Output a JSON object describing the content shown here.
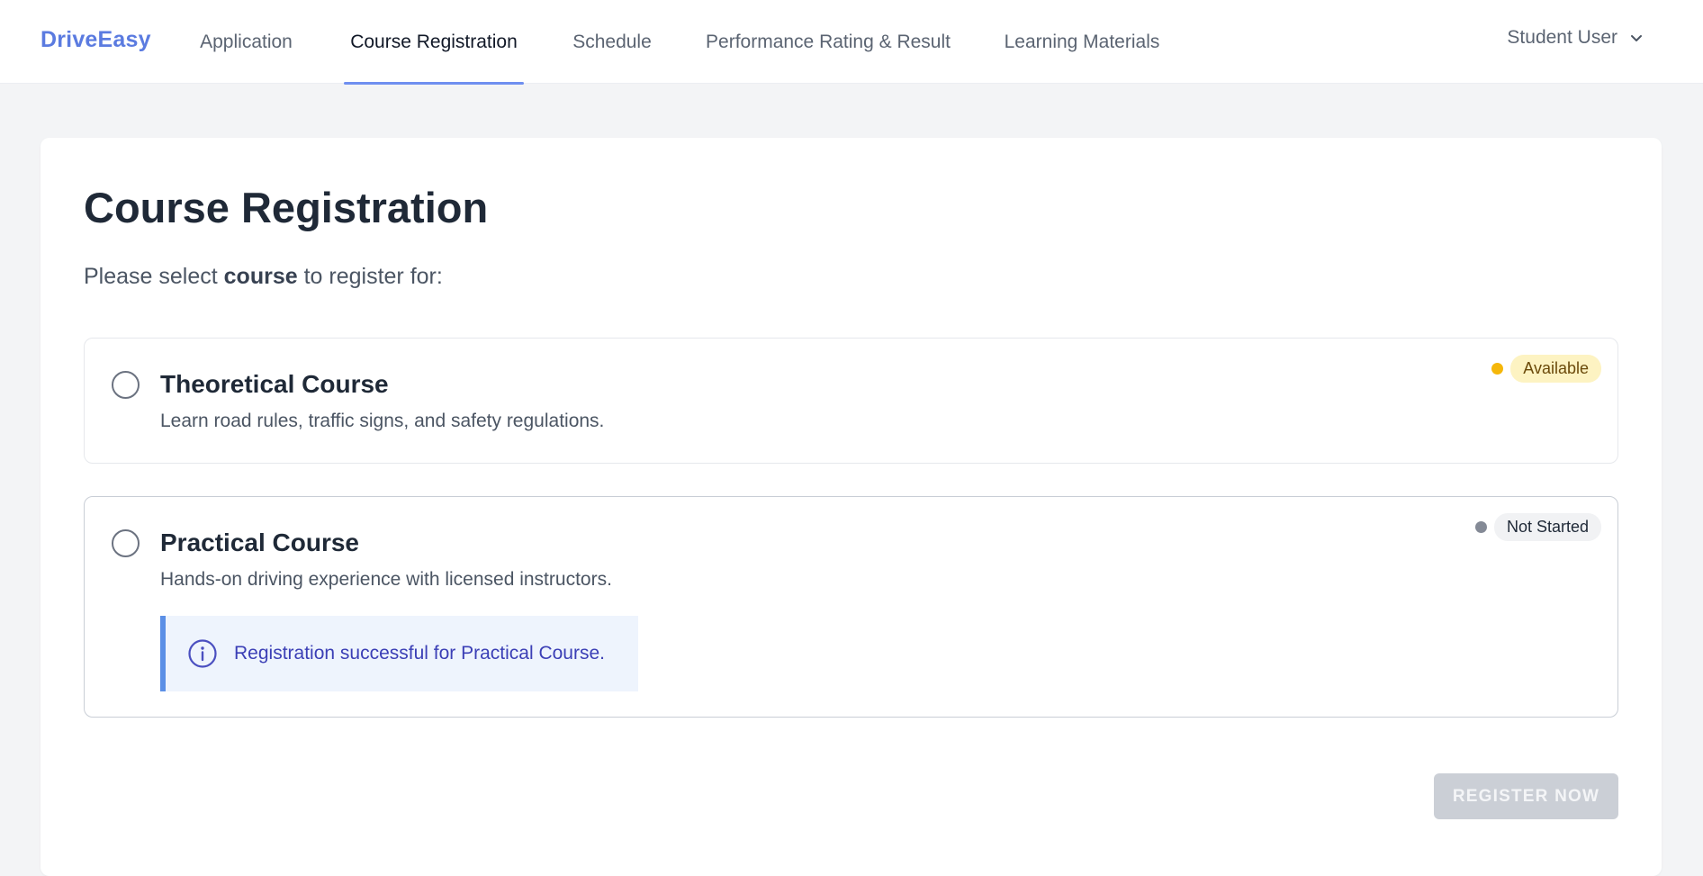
{
  "brand": "DriveEasy",
  "nav": {
    "items": [
      {
        "label": "Application"
      },
      {
        "label": "Course Registration",
        "active": true
      },
      {
        "label": "Schedule"
      },
      {
        "label": "Performance Rating & Result"
      },
      {
        "label": "Learning Materials"
      }
    ]
  },
  "user_menu": {
    "label": "Student User",
    "icon": "chevron-down-icon"
  },
  "page": {
    "title": "Course Registration",
    "subtitle_prefix": "Please select",
    "subtitle_bold": "course",
    "subtitle_suffix": "to register for:"
  },
  "courses": [
    {
      "title": "Theoretical Course",
      "description": "Learn road rules, traffic signs, and safety regulations.",
      "status": "Available",
      "status_color": "#f5b70a",
      "selected": false
    },
    {
      "title": "Practical Course",
      "description": "Hands-on driving experience with licensed instructors.",
      "status": "Not Started",
      "status_color": "#848a96",
      "selected": false,
      "notice": "Registration successful for Practical Course."
    }
  ],
  "actions": {
    "register_label": "REGISTER NOW",
    "register_enabled": false
  },
  "colors": {
    "accent": "#5b7be0",
    "info_border": "#5b8fe6",
    "info_text": "#3b3fb6"
  }
}
